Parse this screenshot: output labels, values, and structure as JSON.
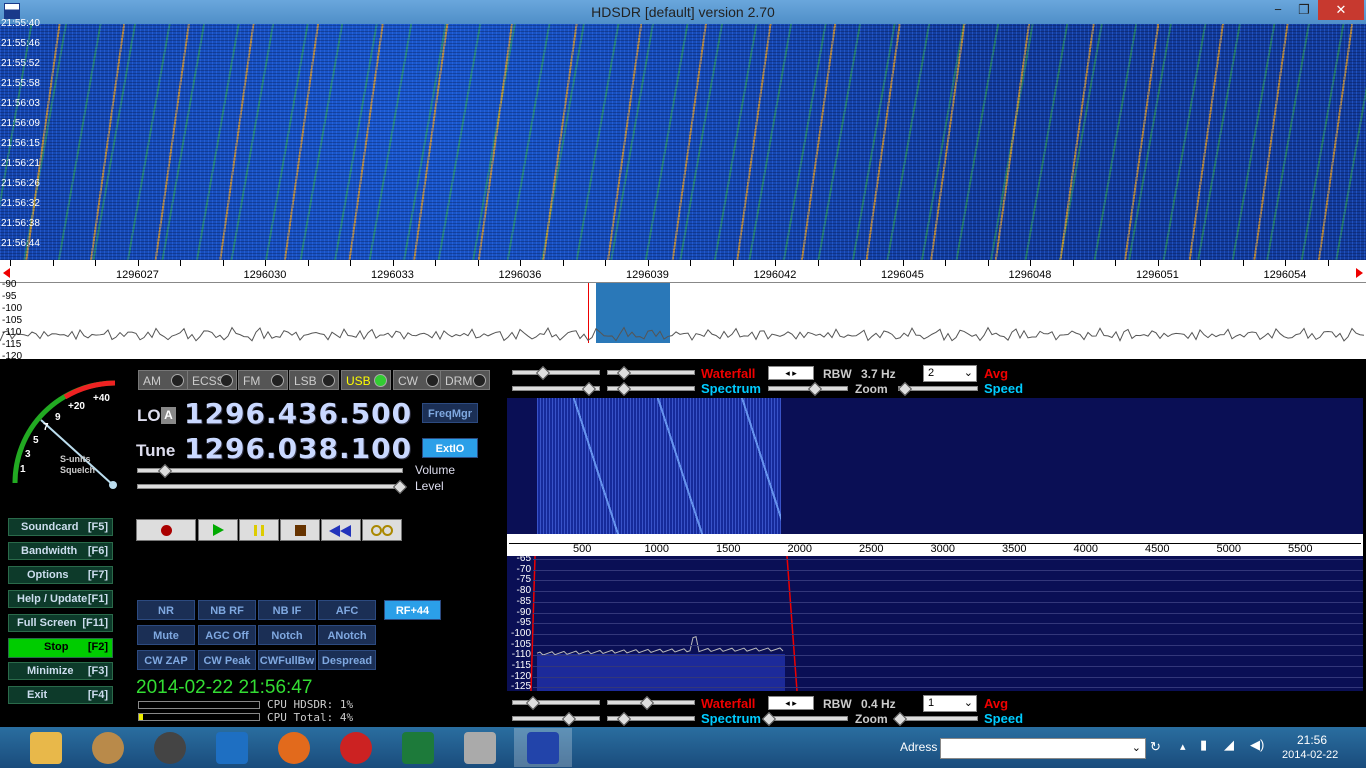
{
  "window": {
    "title": "HDSDR [default]  version 2.70",
    "minimize": "−",
    "restore": "❐",
    "close": "✕"
  },
  "waterfall_top": {
    "times": [
      "21:55:40",
      "21:55:46",
      "21:55:52",
      "21:55:58",
      "21:56:03",
      "21:56:09",
      "21:56:15",
      "21:56:21",
      "21:56:26",
      "21:56:32",
      "21:56:38",
      "21:56:44"
    ]
  },
  "freq_axis": {
    "labels": [
      "1296027",
      "1296030",
      "1296033",
      "1296036",
      "1296039",
      "1296042",
      "1296045",
      "1296048",
      "1296051",
      "1296054"
    ]
  },
  "spectrum_top": {
    "db_labels": [
      "-90",
      "-95",
      "-100",
      "-105",
      "-110",
      "-115",
      "-120"
    ]
  },
  "modes": [
    {
      "label": "AM",
      "active": false
    },
    {
      "label": "ECSS",
      "active": false
    },
    {
      "label": "FM",
      "active": false
    },
    {
      "label": "LSB",
      "active": false
    },
    {
      "label": "USB",
      "active": true
    },
    {
      "label": "CW",
      "active": false
    },
    {
      "label": "DRM",
      "active": false
    }
  ],
  "smeter": {
    "labels": [
      "+40",
      "+20",
      "9",
      "7",
      "5",
      "3",
      "1"
    ],
    "caption1": "S-units",
    "caption2": "Squelch"
  },
  "lo": {
    "label": "LO",
    "badge": "A",
    "value": "1296.436.500"
  },
  "tune": {
    "label": "Tune",
    "value": "1296.038.100"
  },
  "freqmgr": "FreqMgr",
  "extio": "ExtIO",
  "volume_label": "Volume",
  "level_label": "Level",
  "left_buttons": [
    {
      "label": "Soundcard",
      "key": "[F5]"
    },
    {
      "label": "Bandwidth",
      "key": "[F6]"
    },
    {
      "label": "Options",
      "key": "[F7]"
    },
    {
      "label": "Help / Update",
      "key": "[F1]"
    },
    {
      "label": "Full Screen",
      "key": "[F11]"
    },
    {
      "label": "Stop",
      "key": "[F2]"
    },
    {
      "label": "Minimize",
      "key": "[F3]"
    },
    {
      "label": "Exit",
      "key": "[F4]"
    }
  ],
  "dsp_buttons": [
    [
      "NR",
      "NB RF",
      "NB IF",
      "AFC",
      "RF+44"
    ],
    [
      "Mute",
      "AGC Off",
      "Notch",
      "ANotch"
    ],
    [
      "CW ZAP",
      "CW Peak",
      "CWFullBw",
      "Despread"
    ]
  ],
  "clock": "2014-02-22 21:56:47",
  "cpu": {
    "hdsdr": "CPU HDSDR: 1%",
    "total": "CPU Total: 4%"
  },
  "top_controls": {
    "waterfall": "Waterfall",
    "spectrum": "Spectrum",
    "rbw_label": "RBW",
    "rbw": "3.7 Hz",
    "avg": "Avg",
    "zoom": "Zoom",
    "speed": "Speed",
    "dropdown": "2"
  },
  "bottom_controls": {
    "waterfall": "Waterfall",
    "spectrum": "Spectrum",
    "rbw_label": "RBW",
    "rbw": "0.4 Hz",
    "avg": "Avg",
    "zoom": "Zoom",
    "speed": "Speed",
    "dropdown": "1"
  },
  "audio_axis": {
    "labels": [
      "500",
      "1000",
      "1500",
      "2000",
      "2500",
      "3000",
      "3500",
      "4000",
      "4500",
      "5000",
      "5500"
    ]
  },
  "audio_spectrum": {
    "db_labels": [
      "-65",
      "-70",
      "-75",
      "-80",
      "-85",
      "-90",
      "-95",
      "-100",
      "-105",
      "-110",
      "-115",
      "-120",
      "-125"
    ]
  },
  "taskbar": {
    "adress_label": "Adress",
    "time": "21:56",
    "date": "2014-02-22"
  }
}
